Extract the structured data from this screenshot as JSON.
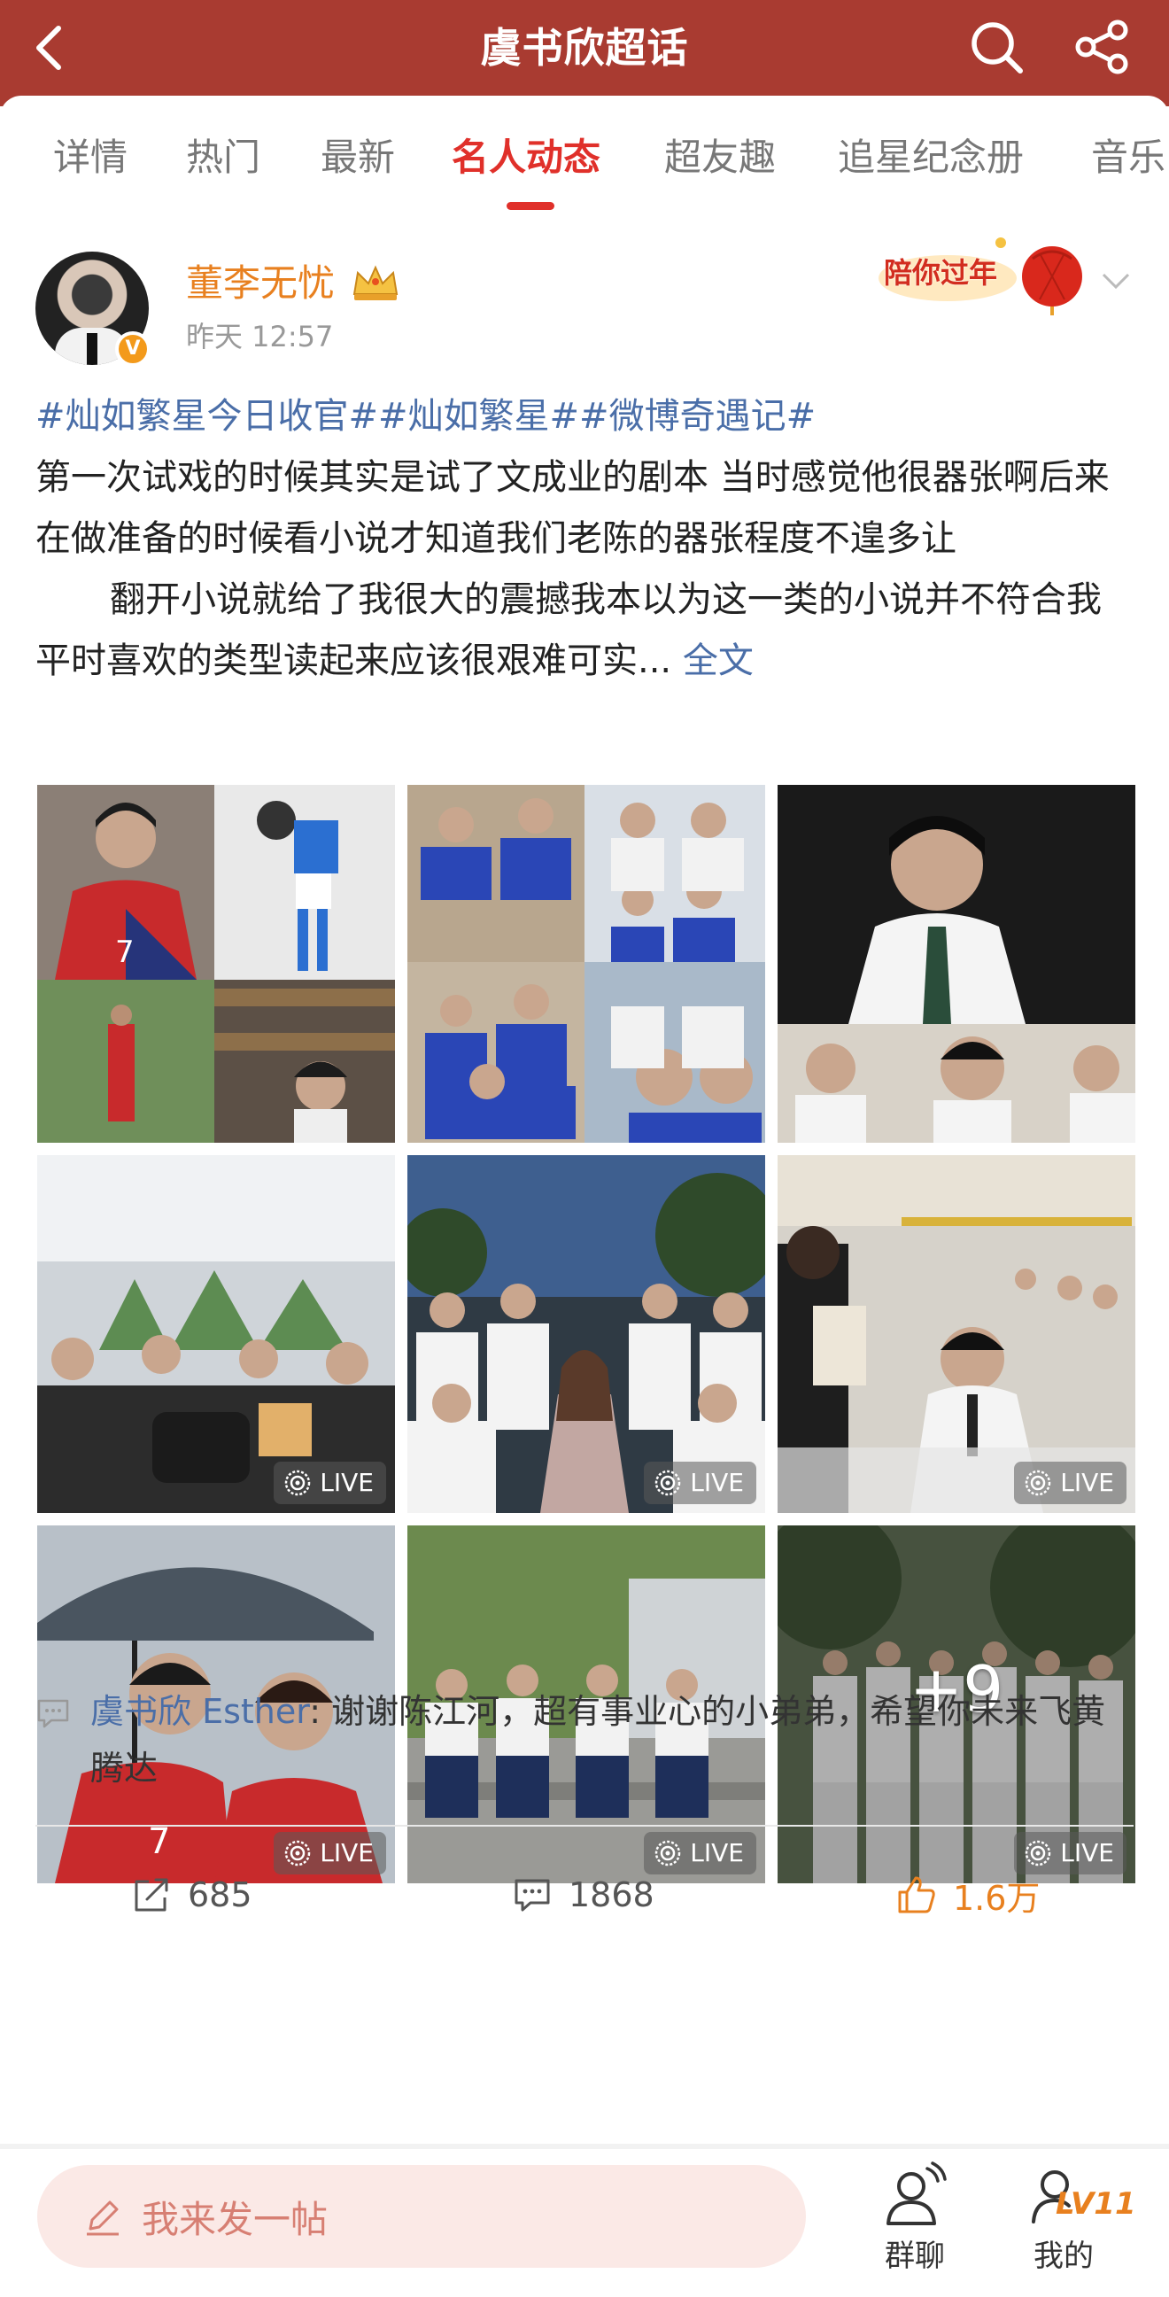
{
  "header": {
    "title": "虞书欣超话"
  },
  "tabs": [
    {
      "label": "详情",
      "active": false
    },
    {
      "label": "热门",
      "active": false
    },
    {
      "label": "最新",
      "active": false
    },
    {
      "label": "名人动态",
      "active": true
    },
    {
      "label": "超友趣",
      "active": false
    },
    {
      "label": "追星纪念册",
      "active": false
    },
    {
      "label": "音乐",
      "active": false
    }
  ],
  "post": {
    "author": "董李无忧",
    "time": "昨天 12:57",
    "verified_badge": "V",
    "promo_badge": "陪你过年",
    "tags": "#灿如繁星今日收官##灿如繁星##微博奇遇记#",
    "paragraph1": "第一次试戏的时候其实是试了文成业的剧本 当时感觉他很器张啊后来在做准备的时候看小说才知道我们老陈的器张程度不遑多让",
    "paragraph2": "翻开小说就给了我很大的震撼我本以为这一类的小说并不符合我平时喜欢的类型读起来应该很艰难可实...",
    "full_text_link": "全文",
    "images": [
      {
        "live": false
      },
      {
        "live": false
      },
      {
        "live": false
      },
      {
        "live": true,
        "live_label": "LIVE"
      },
      {
        "live": true,
        "live_label": "LIVE"
      },
      {
        "live": true,
        "live_label": "LIVE"
      },
      {
        "live": true,
        "live_label": "LIVE"
      },
      {
        "live": true,
        "live_label": "LIVE"
      },
      {
        "live": true,
        "live_label": "LIVE",
        "more_count": "+9"
      }
    ],
    "top_comment": {
      "name": "虞书欣 Esther",
      "text": ": 谢谢陈江河，超有事业心的小弟弟，希望你未来飞黄腾达"
    },
    "stats": {
      "reposts": "685",
      "comments": "1868",
      "likes": "1.6万"
    }
  },
  "bottom_bar": {
    "input_placeholder": "我来发一帖",
    "group_chat_label": "群聊",
    "me_label": "我的",
    "level": "LV11"
  },
  "colors": {
    "header_bg": "#a93b31",
    "active_tab": "#e0302a",
    "link_blue": "#4a6ea8",
    "username_orange": "#e8801f"
  }
}
